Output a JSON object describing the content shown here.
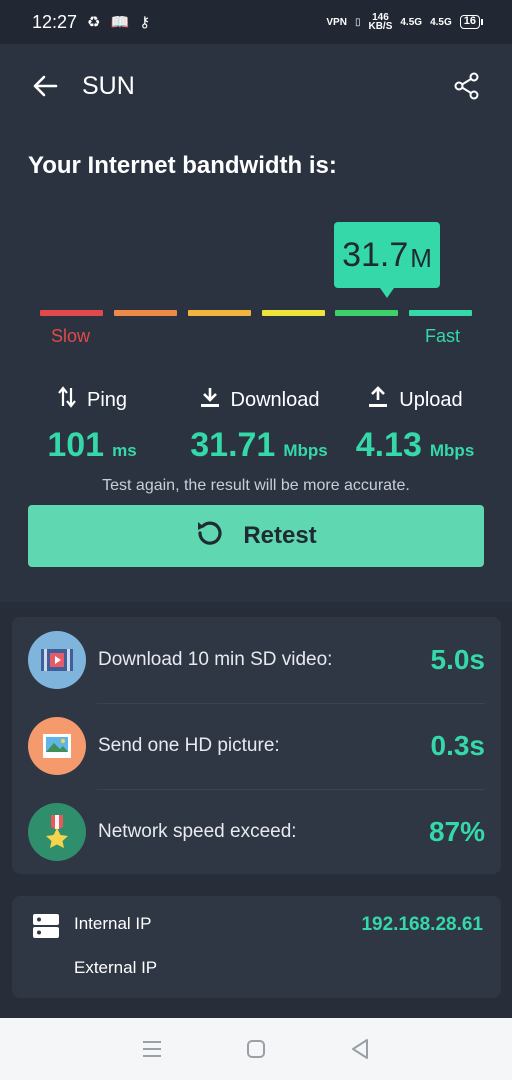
{
  "status_bar": {
    "time": "12:27",
    "vpn": "VPN",
    "net_speed_value": "146",
    "net_speed_unit": "KB/S",
    "sim1": "4.5G",
    "sim2": "4.5G",
    "battery": "16"
  },
  "app_bar": {
    "title": "SUN"
  },
  "bandwidth": {
    "heading": "Your Internet bandwidth is:",
    "value": "31.7",
    "unit": "M",
    "slow_label": "Slow",
    "fast_label": "Fast",
    "segment_colors": [
      "#e04a4a",
      "#ee8a48",
      "#f2b43c",
      "#f0e23c",
      "#3dd16a",
      "#35d8a8"
    ],
    "active_segment": 5
  },
  "metrics": {
    "ping": {
      "label": "Ping",
      "value": "101",
      "unit": "ms"
    },
    "download": {
      "label": "Download",
      "value": "31.71",
      "unit": "Mbps"
    },
    "upload": {
      "label": "Upload",
      "value": "4.13",
      "unit": "Mbps"
    }
  },
  "hint": "Test again, the result will be more accurate.",
  "retest_label": "Retest",
  "info": [
    {
      "icon": "video-icon",
      "label": "Download 10 min SD video:",
      "value": "5.0s"
    },
    {
      "icon": "picture-icon",
      "label": "Send one HD picture:",
      "value": "0.3s"
    },
    {
      "icon": "medal-icon",
      "label": "Network speed exceed:",
      "value": "87%"
    }
  ],
  "ip": {
    "internal_label": "Internal IP",
    "internal_value": "192.168.28.61",
    "external_label": "External IP"
  },
  "colors": {
    "accent": "#35d8a8",
    "background": "#272d39",
    "card": "#2f3644"
  }
}
